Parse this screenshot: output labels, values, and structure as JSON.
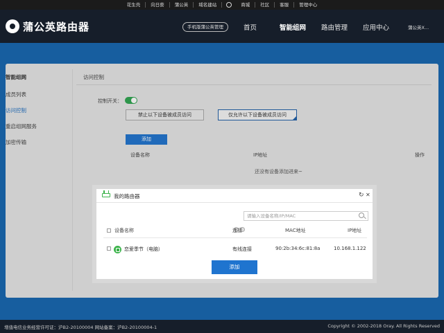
{
  "topbar": {
    "links": [
      "花生壳",
      "向日葵",
      "蒲公英",
      "域名建站",
      "",
      "商城",
      "社区",
      "客服",
      "管理中心"
    ]
  },
  "header": {
    "brand": "蒲公英路由器",
    "manage_button": "手机版蒲公英管理",
    "nav": [
      "首页",
      "智能组网",
      "路由管理",
      "应用中心"
    ],
    "user": "蒲公英X..."
  },
  "sidebar": {
    "title": "智能组网",
    "items": [
      "成员列表",
      "访问控制",
      "重启组网服务",
      "加密传输"
    ]
  },
  "main": {
    "title": "访问控制",
    "switch_label": "控制开关：",
    "mode_deny": "禁止以下设备被成员访问",
    "mode_allow": "仅允许以下设备被成员访问",
    "add_button": "添加",
    "table_headers": [
      "设备名称",
      "IP地址",
      "操作"
    ],
    "empty_text": "还没有设备添加进来~"
  },
  "dialog": {
    "title": "我的路由器",
    "search_placeholder": "请输入设备名称/IP/MAC",
    "headers": {
      "name": "设备名称",
      "connection": "连接",
      "mac": "MAC地址",
      "ip": "IP地址"
    },
    "rows": [
      {
        "name": "恋爱季节（电脑）",
        "connection": "有线连接",
        "mac": "90:2b:34:6c:81:8a",
        "ip": "10.168.1.122"
      }
    ],
    "add_button": "添加"
  },
  "footer": {
    "left": "增值电信业务经营许可证：沪B2-20100004   网站备案：沪B2-20100004-1",
    "right": "Copyright © 2002-2018 Oray. All Rights Reserved"
  },
  "colors": {
    "accent": "#1f74cf",
    "header_bg": "#161e2a",
    "page_bg": "#1566b0",
    "toggle_on": "#2ea44f"
  }
}
